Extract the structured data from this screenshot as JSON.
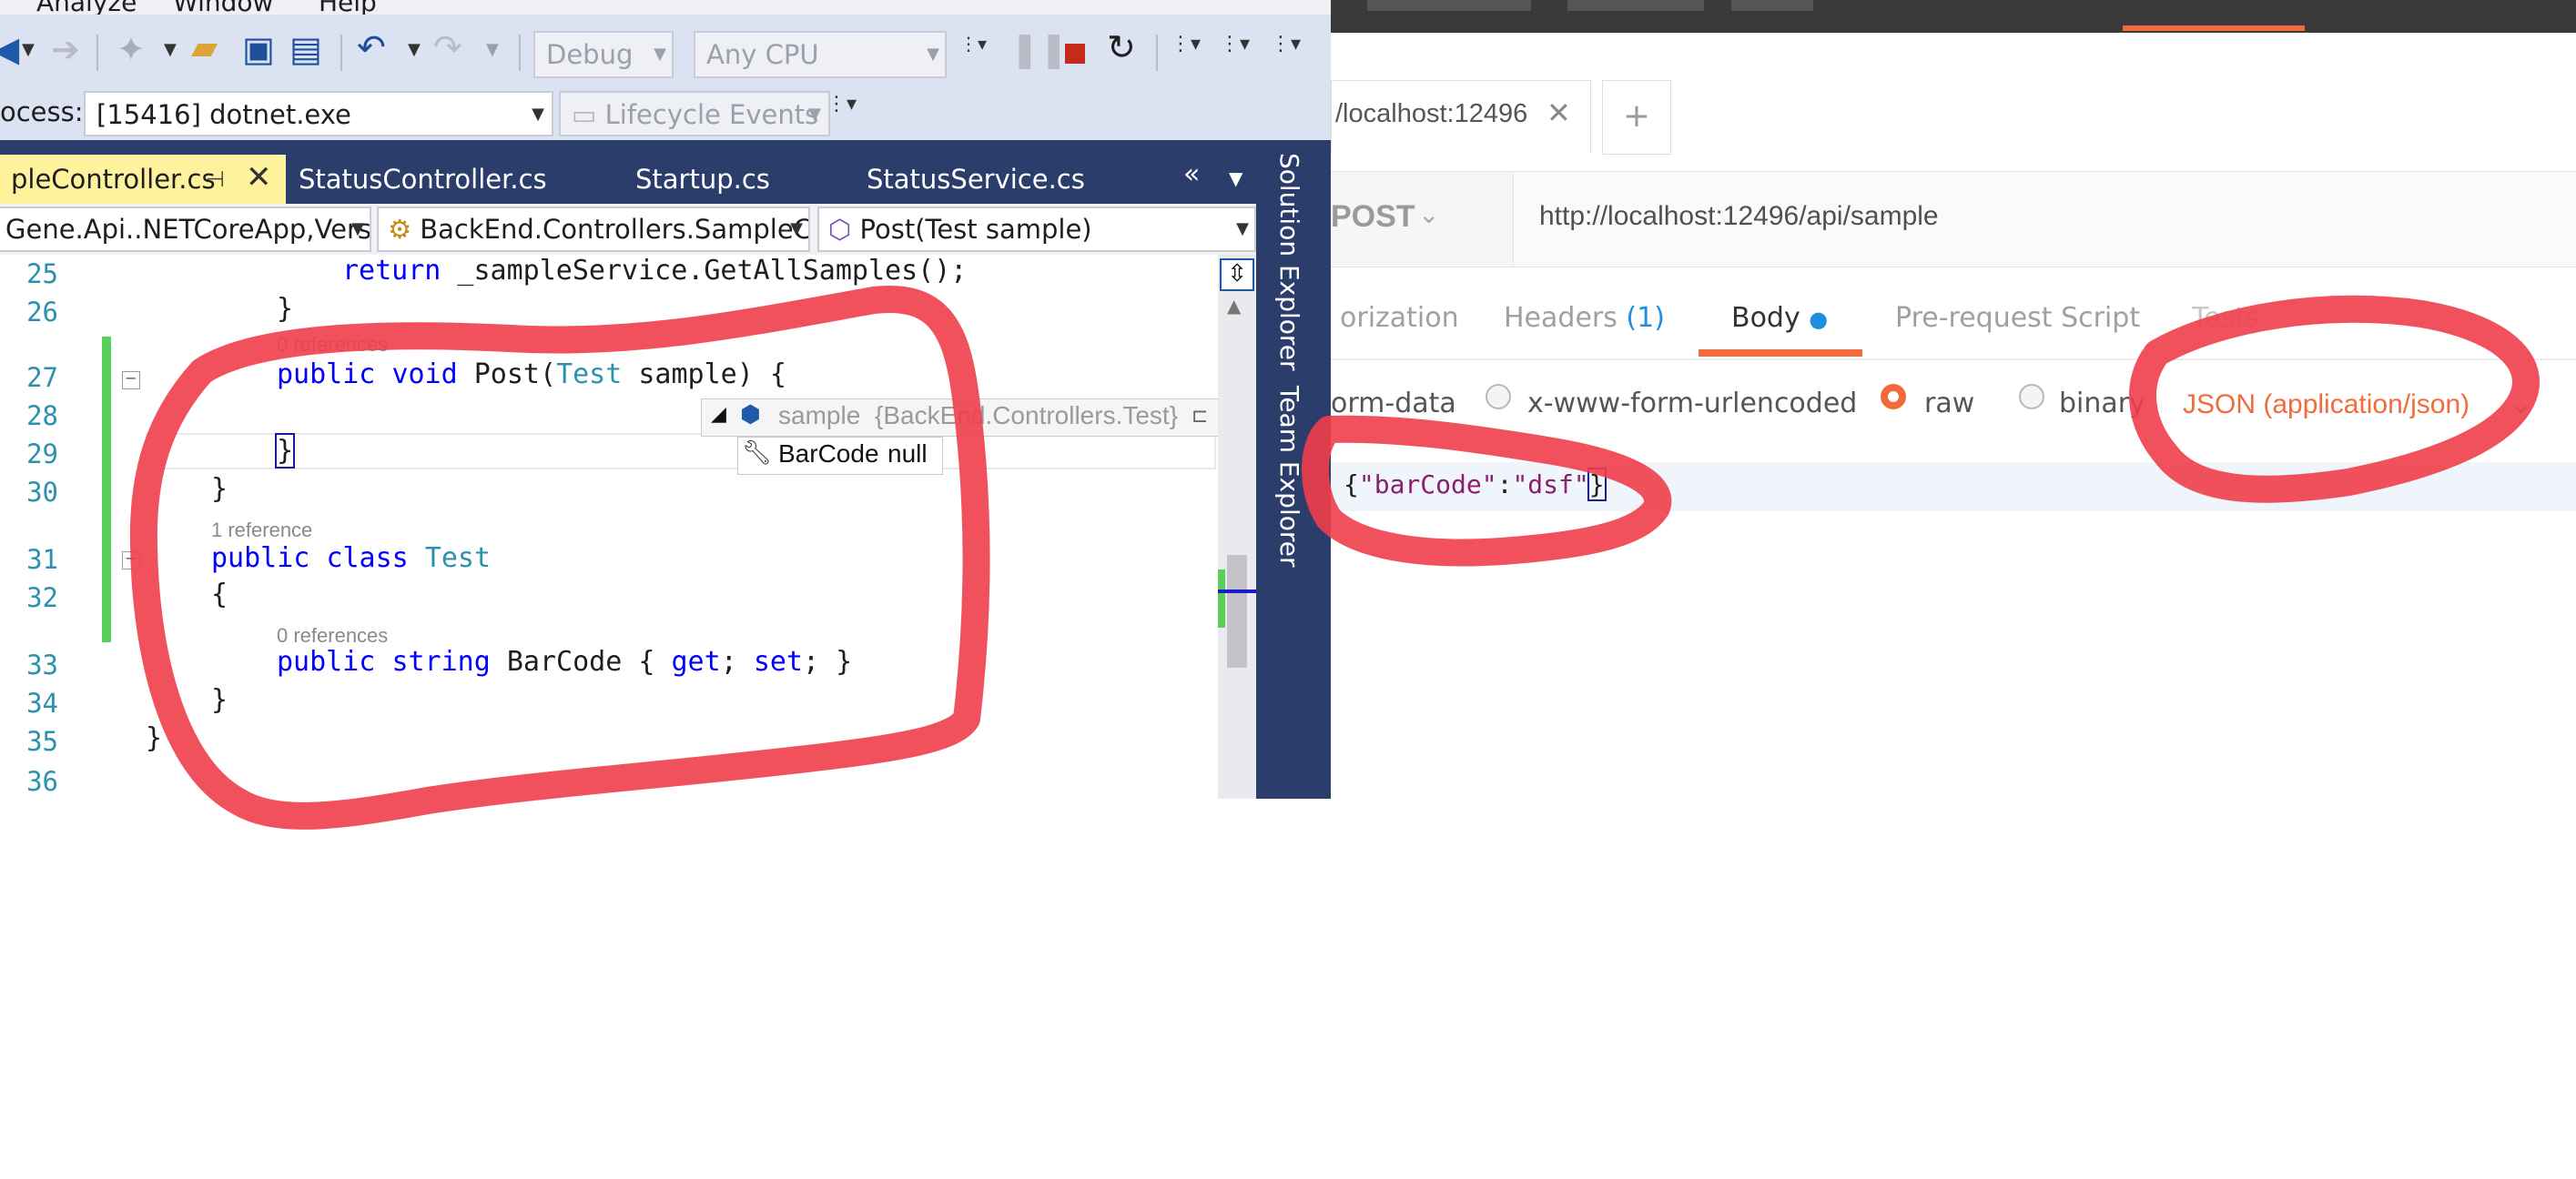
{
  "vs": {
    "menu": {
      "analyze": "Analyze",
      "window": "Window",
      "help": "Help"
    },
    "toolbar": {
      "config": "Debug",
      "platform": "Any CPU",
      "process_label": "ocess:",
      "process_value": "[15416] dotnet.exe",
      "lifecycle": "Lifecycle Events"
    },
    "tabs": [
      {
        "label": "pleController.cs"
      },
      {
        "label": "StatusController.cs"
      },
      {
        "label": "Startup.cs"
      },
      {
        "label": "StatusService.cs"
      }
    ],
    "navbar": {
      "project": "Gene.Api..NETCoreApp,Versic",
      "class": "BackEnd.Controllers.SampleC",
      "member": "Post(Test sample)"
    },
    "side_panels": {
      "solution": "Solution Explorer",
      "team": "Team Explorer"
    },
    "lines": {
      "l25": "25",
      "l26": "26",
      "l27": "27",
      "l28": "28",
      "l29": "29",
      "l30": "30",
      "l31": "31",
      "l32": "32",
      "l33": "33",
      "l34": "34",
      "l35": "35",
      "l36": "36"
    },
    "code": {
      "c25_return": "return",
      "c25_rest": " _sampleService.GetAllSamples();",
      "c26": "}",
      "lens_27": "0 references",
      "c27_public": "public",
      "c27_void": "void",
      "c27_post": "Post(",
      "c27_test": "Test",
      "c27_rest": " sample) {",
      "c29": "}",
      "c30": "}",
      "lens_31": "1 reference",
      "c31_public": "public",
      "c31_class": "class",
      "c31_test": "Test",
      "c32": "{",
      "lens_33": "0 references",
      "c33_public": "public",
      "c33_string": "string",
      "c33_name": " BarCode { ",
      "c33_get": "get",
      "c33_mid": "; ",
      "c33_set": "set",
      "c33_end": "; }",
      "c34": "}",
      "c35": "}"
    },
    "datatip": {
      "name": "sample",
      "type": "{BackEnd.Controllers.Test}",
      "prop": "BarCode",
      "value": "null"
    }
  },
  "postman": {
    "tab_title": "/localhost:12496",
    "method": "POST",
    "url": "http://localhost:12496/api/sample",
    "req_tabs": {
      "auth": "orization",
      "headers": "Headers",
      "headers_count": "(1)",
      "body": "Body",
      "prerequest": "Pre-request Script",
      "tests": "Tests"
    },
    "body_types": {
      "formdata": "orm-data",
      "urlencoded": "x-www-form-urlencoded",
      "raw": "raw",
      "binary": "binary"
    },
    "content_type": "JSON (application/json)",
    "json": {
      "open": "{",
      "key": "\"barCode\"",
      "colon": ":",
      "value": "\"dsf\"",
      "close": "}"
    }
  },
  "colors": {
    "accent": "#f26b3a",
    "annotation": "#ef3e4a",
    "vs_tab": "#2b3d6b",
    "active_tab": "#fff29d"
  }
}
